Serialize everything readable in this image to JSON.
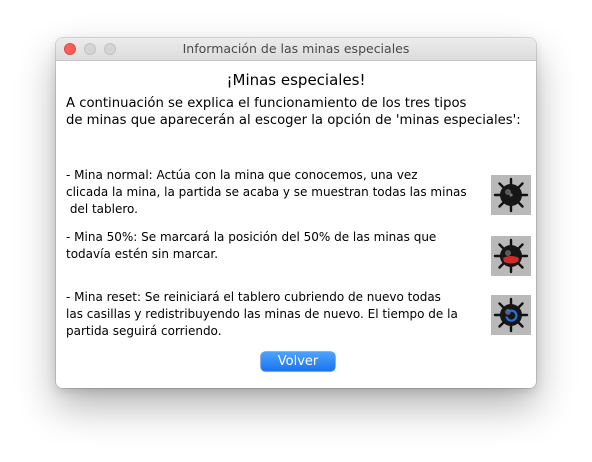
{
  "window": {
    "title": "Información de las minas especiales"
  },
  "content": {
    "heading": "¡Minas especiales!",
    "intro": "A continuación se explica el funcionamiento de los tres tipos\nde minas que aparecerán al escoger la opción de 'minas especiales':",
    "mines": [
      {
        "description": "- Mina normal: Actúa con la mina que conocemos, una vez\nclicada la mina, la partida se acaba y se muestran todas las minas\n del tablero.",
        "icon": "mine-normal-icon"
      },
      {
        "description": "- Mina 50%: Se marcará la posición del 50% de las minas que\ntodavía estén sin marcar.",
        "icon": "mine-50-icon"
      },
      {
        "description": "- Mina reset: Se reiniciará el tablero cubriendo de nuevo todas\nlas casillas y redistribuyendo las minas de nuevo. El tiempo de la\npartida seguirá corriendo.",
        "icon": "mine-reset-icon"
      }
    ]
  },
  "buttons": {
    "volver_label": "Volver"
  },
  "colors": {
    "accent": "#1b74f1",
    "mine_background": "#b9b9b9",
    "mine_50_marker": "#d22a2a",
    "mine_reset_marker": "#2f6fd8"
  }
}
